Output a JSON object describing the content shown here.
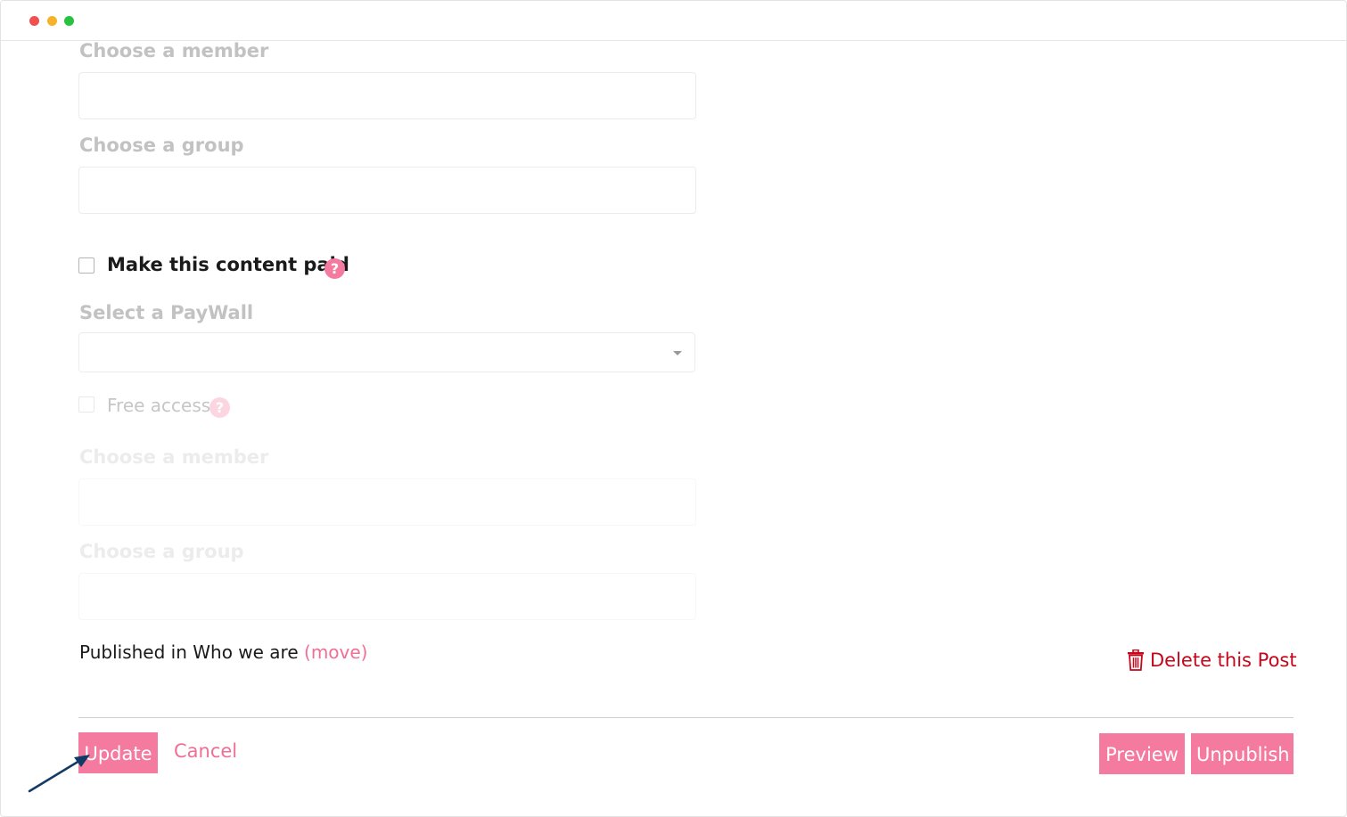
{
  "window": {
    "controls": {
      "close_color": "#f0504f",
      "minimize_color": "#f7b22b",
      "maximize_color": "#27c23f"
    }
  },
  "form": {
    "member_label_1": "Choose a member",
    "group_label_1": "Choose a group",
    "paid_checkbox_label": "Make this content paid",
    "paid_checked": false,
    "help_glyph": "?",
    "paywall_label": "Select a PayWall",
    "paywall_value": "",
    "free_access_label": "Free access:",
    "free_access_checked": false,
    "member_label_2": "Choose a member",
    "group_label_2": "Choose a group"
  },
  "publish": {
    "published_in_text": "Published in Who we are",
    "move_link": "(move)",
    "delete_label": "Delete this Post"
  },
  "actions": {
    "update_label": "Update",
    "cancel_label": "Cancel",
    "preview_label": "Preview",
    "unpublish_label": "Unpublish"
  },
  "colors": {
    "accent": "#f47aa0",
    "link": "#f06f96",
    "danger": "#c4071a",
    "annotation_arrow": "#123a66"
  },
  "icons": {
    "help": "help-icon",
    "delete": "trash-icon",
    "select_caret": "caret-down-icon"
  }
}
